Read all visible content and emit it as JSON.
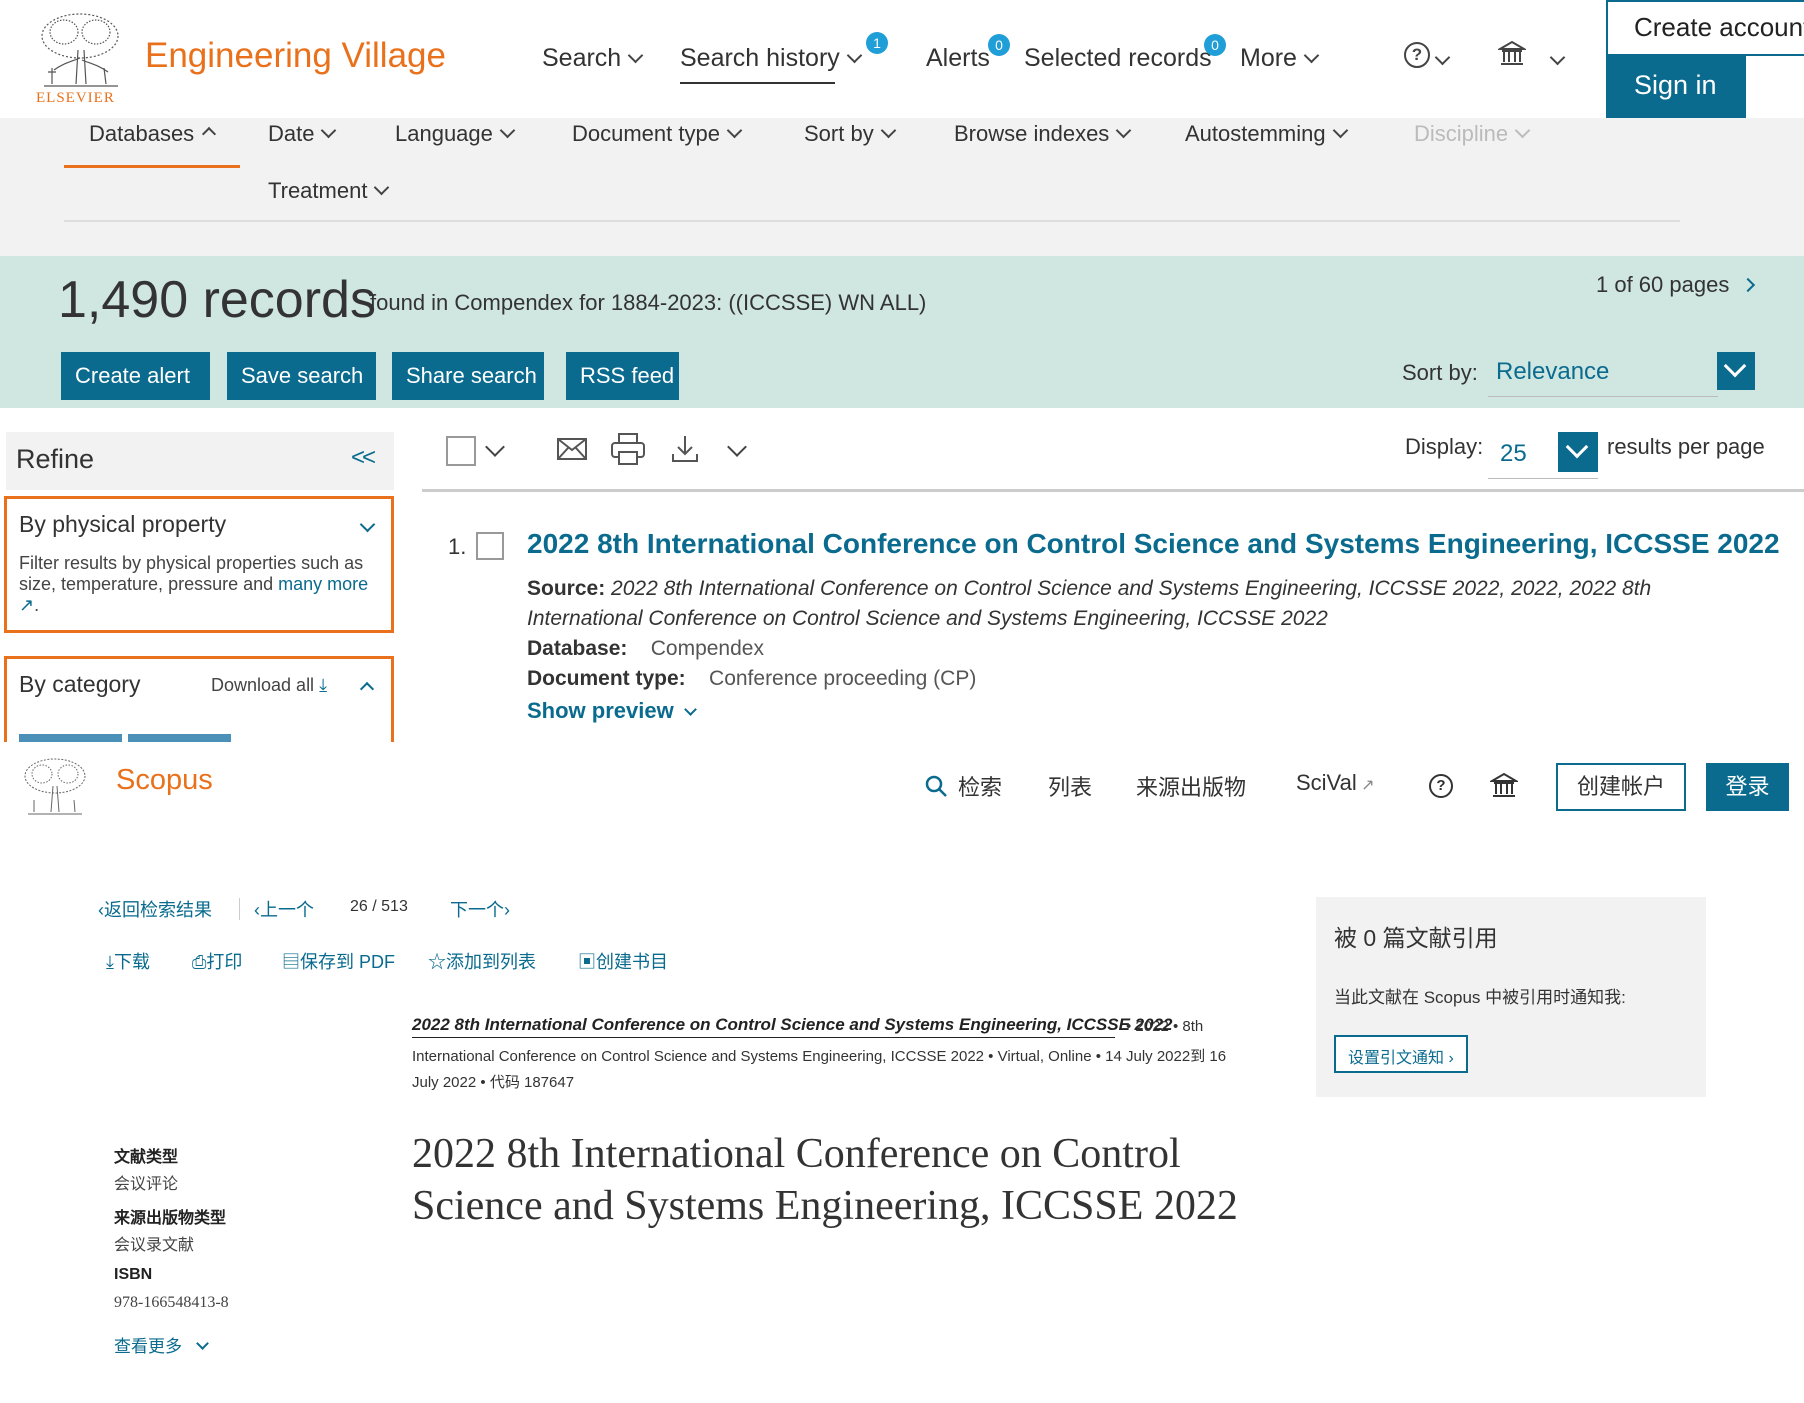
{
  "ev": {
    "publisher": "ELSEVIER",
    "brand": "Engineering Village",
    "nav": [
      {
        "label": "Search"
      },
      {
        "label": "Search history",
        "badge": "1"
      },
      {
        "label": "Alerts",
        "badge": "0"
      },
      {
        "label": "Selected records",
        "badge": "0"
      },
      {
        "label": "More"
      }
    ],
    "help_symbol": "?",
    "create_account": "Create account",
    "sign_in": "Sign in",
    "filters": [
      "Databases",
      "Date",
      "Language",
      "Document type",
      "Sort by",
      "Browse indexes",
      "Autostemming",
      "Discipline",
      "Treatment"
    ],
    "results": {
      "count": "1,490 records",
      "found_text": "found in Compendex for 1884-2023: ((ICCSSE) WN ALL)",
      "pages": "1 of 60 pages",
      "buttons": [
        "Create alert",
        "Save search",
        "Share search",
        "RSS feed"
      ],
      "sort_label": "Sort by:",
      "sort_value": "Relevance",
      "display_label": "Display:",
      "display_value": "25",
      "per_page": "results per page"
    },
    "refine": {
      "title": "Refine",
      "collapse": "<<",
      "physical_title": "By physical property",
      "physical_text": "Filter results by physical properties such as size, temperature, pressure and",
      "physical_link": "many more",
      "category_title": "By category",
      "download_all": "Download all"
    },
    "record": {
      "number": "1.",
      "title": "2022 8th International Conference on Control Science and Systems Engineering, ICCSSE 2022",
      "source_label": "Source:",
      "source_line1": "2022 8th International Conference on Control Science and Systems Engineering, ICCSSE 2022, 2022, 2022 8th",
      "source_line2": "International Conference on Control Science and Systems Engineering, ICCSSE 2022",
      "database_label": "Database:",
      "database_value": "Compendex",
      "doctype_label": "Document type:",
      "doctype_value": "Conference proceeding (CP)",
      "show_preview": "Show preview"
    }
  },
  "scopus": {
    "brand": "Scopus",
    "nav": [
      "检索",
      "列表",
      "来源出版物",
      "SciVal"
    ],
    "create_account": "创建帐户",
    "login": "登录",
    "back": "返回检索结果",
    "prev": "上一个",
    "position": "26",
    "total": "513",
    "next": "下一个",
    "actions": [
      "下载",
      "打印",
      "保存到 PDF",
      "添加到列表",
      "创建书目"
    ],
    "source_title": "2022 8th International Conference on Control Science and Systems Engineering, ICCSSE 2022",
    "source_meta1": "2022",
    "source_meta2": "8th",
    "source_line2": "International Conference on Control Science and Systems Engineering, ICCSSE 2022",
    "source_venue": "Virtual, Online",
    "source_dates": "14 July 2022到 16",
    "source_line3a": "July 2022",
    "source_code": "代码 187647",
    "title_line1": "2022 8th International Conference on Control",
    "title_line2": "Science and Systems Engineering, ICCSSE 2022",
    "side": [
      {
        "label": "文献类型",
        "value": "会议评论"
      },
      {
        "label": "来源出版物类型",
        "value": "会议录文献"
      },
      {
        "label": "ISBN",
        "value": "978-166548413-8"
      }
    ],
    "see_more": "查看更多",
    "cited_by": "被 0 篇文献引用",
    "notify_text": "当此文献在 Scopus 中被引用时通知我:",
    "notify_button": "设置引文通知"
  }
}
